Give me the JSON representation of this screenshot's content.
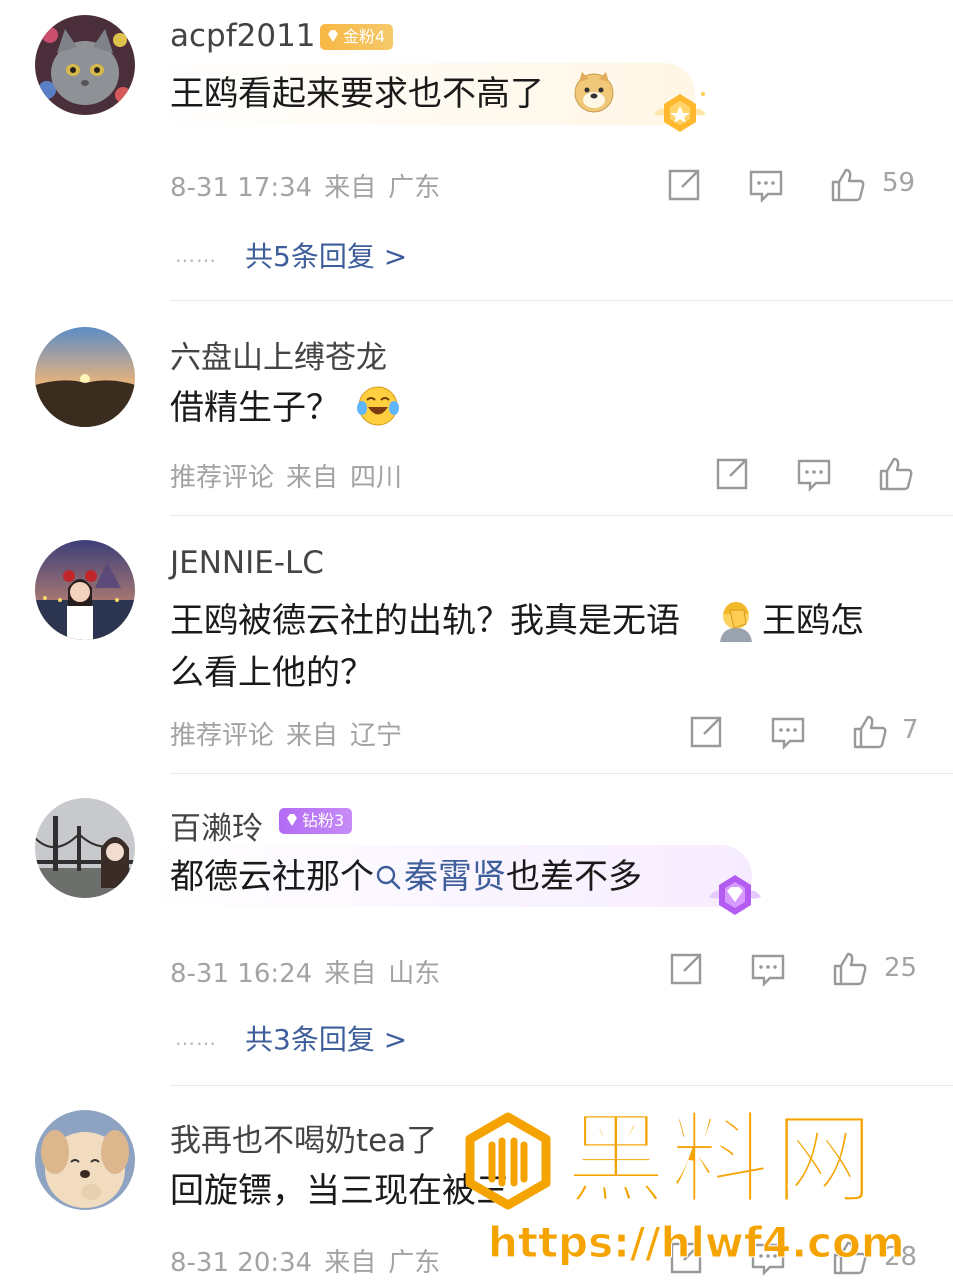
{
  "comments": [
    {
      "username": "acpf2011",
      "badge": "金粉4",
      "text": "王鸥看起来要求也不高了",
      "time": "8-31 17:34",
      "from": "来自",
      "location": "广东",
      "likes": "59",
      "replies": "共5条回复 >",
      "dots": "……"
    },
    {
      "username": "六盘山上缚苍龙",
      "text": "借精生子？",
      "time": "推荐评论",
      "from": "来自",
      "location": "四川"
    },
    {
      "username": "JENNIE-LC",
      "text_line1": "王鸥被德云社的出轨？我真是无语",
      "text_line1_b": "，王鸥怎",
      "text_line2": "么看上他的？",
      "time": "推荐评论",
      "from": "来自",
      "location": "辽宁",
      "likes": "7"
    },
    {
      "username": "百濑玲",
      "badge": "钻粉3",
      "text_before": "都德云社那个",
      "topic": "秦霄贤",
      "text_after": "也差不多",
      "time": "8-31 16:24",
      "from": "来自",
      "location": "山东",
      "likes": "25",
      "replies": "共3条回复 >",
      "dots": "……"
    },
    {
      "username": "我再也不喝奶tea了",
      "text": "回旋镖，当三现在被三",
      "time": "8-31 20:34",
      "from": "来自",
      "location": "广东",
      "likes": "28"
    }
  ],
  "watermark": {
    "title": "黑料网",
    "url": "https://hlwf4.com"
  },
  "colors": {
    "link": "#3d5e9a",
    "meta": "#a3a3a3",
    "gold_badge": "#f7b744",
    "diamond_badge": "#b26bf4",
    "watermark": "#f5a300"
  }
}
